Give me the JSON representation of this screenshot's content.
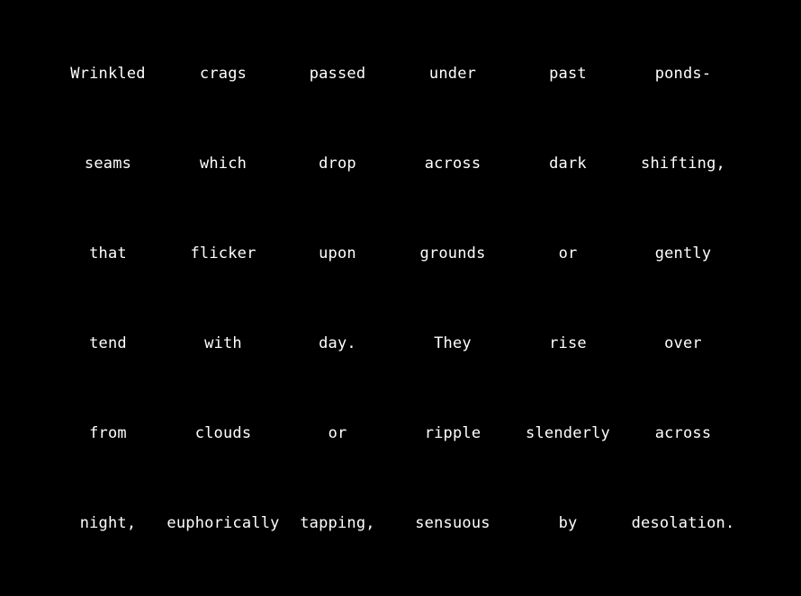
{
  "background_color": "#000000",
  "text_color": "#ffffff",
  "rows": [
    [
      "Wrinkled",
      "crags",
      "passed",
      "under",
      "past",
      "ponds-"
    ],
    [
      "seams",
      "which",
      "drop",
      "across",
      "dark",
      "shifting,"
    ],
    [
      "that",
      "flicker",
      "upon",
      "grounds",
      "or",
      "gently"
    ],
    [
      "tend",
      "with",
      "day.",
      "They",
      "rise",
      "over"
    ],
    [
      "from",
      "clouds",
      "or",
      "ripple",
      "slenderly",
      "across"
    ],
    [
      "night,",
      "euphorically",
      "tapping,",
      "sensuous",
      "by",
      "desolation."
    ]
  ]
}
